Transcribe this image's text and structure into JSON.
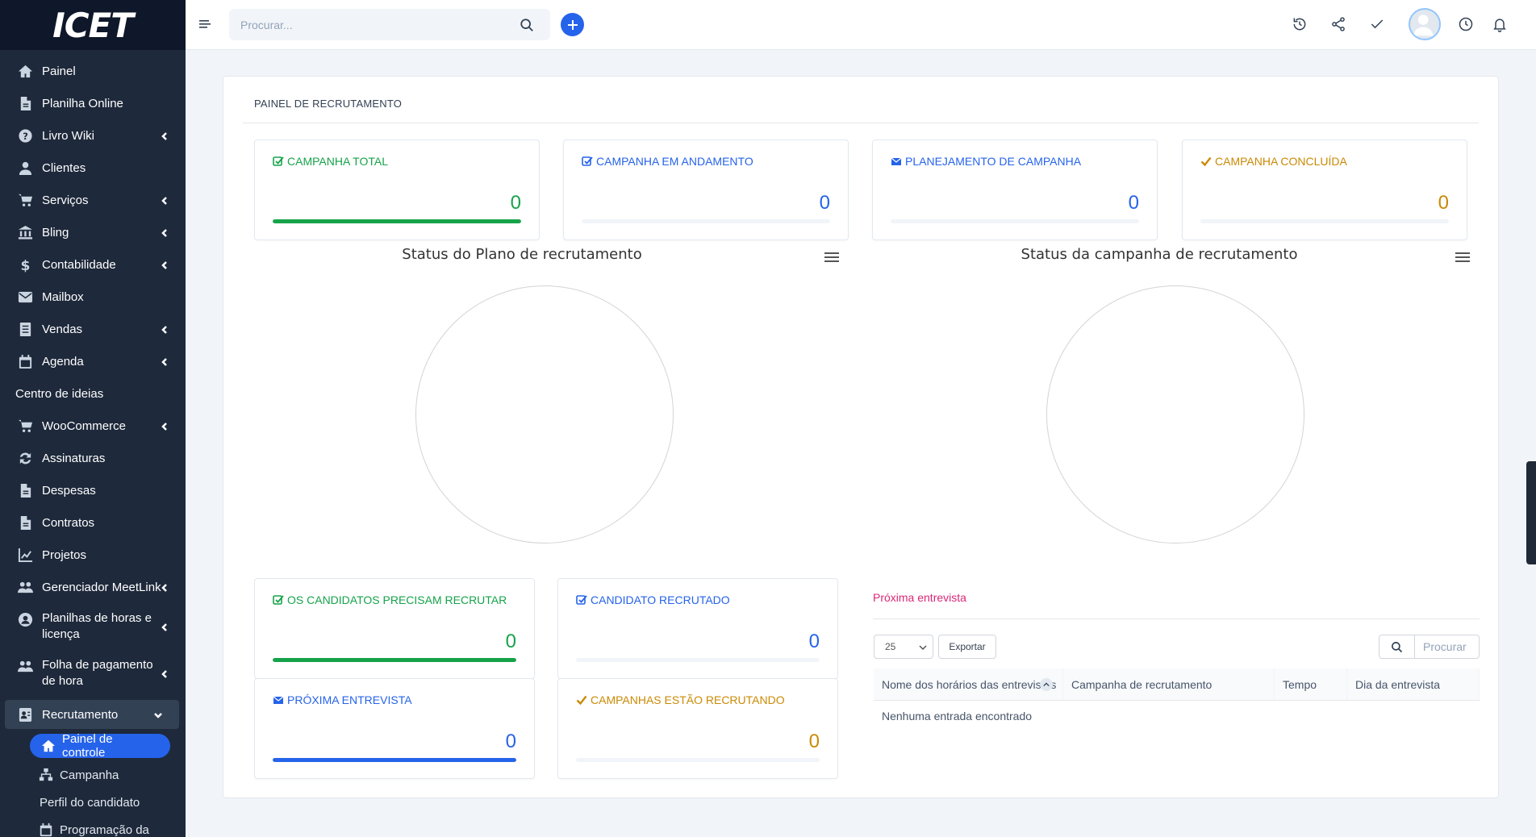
{
  "logo": "ICET",
  "sidebar": {
    "items": [
      {
        "label": "Painel",
        "icon": "home-icon",
        "chevron": false
      },
      {
        "label": "Planilha Online",
        "icon": "file-icon",
        "chevron": false
      },
      {
        "label": "Livro Wiki",
        "icon": "question-icon",
        "chevron": true
      },
      {
        "label": "Clientes",
        "icon": "user-icon",
        "chevron": false
      },
      {
        "label": "Serviços",
        "icon": "cart-icon",
        "chevron": true
      },
      {
        "label": "Bling",
        "icon": "bank-icon",
        "chevron": true
      },
      {
        "label": "Contabilidade",
        "icon": "dollar-icon",
        "chevron": true
      },
      {
        "label": "Mailbox",
        "icon": "mail-icon",
        "chevron": false
      },
      {
        "label": "Vendas",
        "icon": "document-icon",
        "chevron": true
      },
      {
        "label": "Agenda",
        "icon": "calendar-icon",
        "chevron": true
      },
      {
        "label": "Centro de ideias",
        "icon": "",
        "chevron": false
      },
      {
        "label": "WooCommerce",
        "icon": "cart-icon",
        "chevron": true
      },
      {
        "label": "Assinaturas",
        "icon": "refresh-icon",
        "chevron": false
      },
      {
        "label": "Despesas",
        "icon": "file-icon",
        "chevron": false
      },
      {
        "label": "Contratos",
        "icon": "file-icon",
        "chevron": false
      },
      {
        "label": "Projetos",
        "icon": "chart-icon",
        "chevron": false
      },
      {
        "label": "Gerenciador MeetLink",
        "icon": "users-icon",
        "chevron": true
      },
      {
        "label": "Planilhas de horas e licença",
        "icon": "user-circle-icon",
        "chevron": true
      },
      {
        "label": "Folha de pagamento de hora",
        "icon": "users-icon",
        "chevron": true
      },
      {
        "label": "Recrutamento",
        "icon": "id-card-icon",
        "chevron": true
      }
    ],
    "sub_items": [
      {
        "label": "Painel de controle",
        "icon": "home-icon"
      },
      {
        "label": "Campanha",
        "icon": "sitemap-icon"
      },
      {
        "label": "Perfil do candidato",
        "icon": ""
      },
      {
        "label": "Programação da",
        "icon": "calendar-icon"
      }
    ]
  },
  "topbar": {
    "search_placeholder": "Procurar...",
    "icons": [
      "history-icon",
      "share-icon",
      "check-icon",
      "avatar",
      "clock-icon",
      "bell-icon"
    ]
  },
  "panel": {
    "title": "PAINEL DE RECRUTAMENTO",
    "top_stats": [
      {
        "label": "CAMPANHA TOTAL",
        "value": "0",
        "color": "#16a34a",
        "icon": "check-square-icon",
        "fill": 1.0
      },
      {
        "label": "CAMPANHA EM ANDAMENTO",
        "value": "0",
        "color": "#2563eb",
        "icon": "check-square-icon",
        "fill": 0
      },
      {
        "label": "PLANEJAMENTO DE CAMPANHA",
        "value": "0",
        "color": "#2563eb",
        "icon": "envelope-icon",
        "fill": 0
      },
      {
        "label": "CAMPANHA CONCLUÍDA",
        "value": "0",
        "color": "#ca8a04",
        "icon": "check-icon",
        "fill": 0
      }
    ],
    "charts": [
      {
        "title": "Status do Plano de recrutamento"
      },
      {
        "title": "Status da campanha de recrutamento"
      }
    ],
    "bottom_stats": [
      {
        "label": "OS CANDIDATOS PRECISAM RECRUTAR",
        "value": "0",
        "color": "#16a34a",
        "icon": "check-square-icon",
        "fill": 1.0
      },
      {
        "label": "CANDIDATO RECRUTADO",
        "value": "0",
        "color": "#2563eb",
        "icon": "check-square-icon",
        "fill": 0
      },
      {
        "label": "PRÓXIMA ENTREVISTA",
        "value": "0",
        "color": "#2563eb",
        "icon": "envelope-icon",
        "fill": 1.0
      },
      {
        "label": "CAMPANHAS ESTÃO RECRUTANDO",
        "value": "0",
        "color": "#ca8a04",
        "icon": "check-icon",
        "fill": 0
      }
    ],
    "interviews": {
      "title": "Próxima entrevista",
      "page_length": "25",
      "export_label": "Exportar",
      "search_placeholder": "Procurar",
      "columns": [
        "Nome dos horários das entrevistas",
        "Campanha de recrutamento",
        "Tempo",
        "Dia da entrevista"
      ],
      "empty_text": "Nenhuma entrada encontrado"
    }
  }
}
